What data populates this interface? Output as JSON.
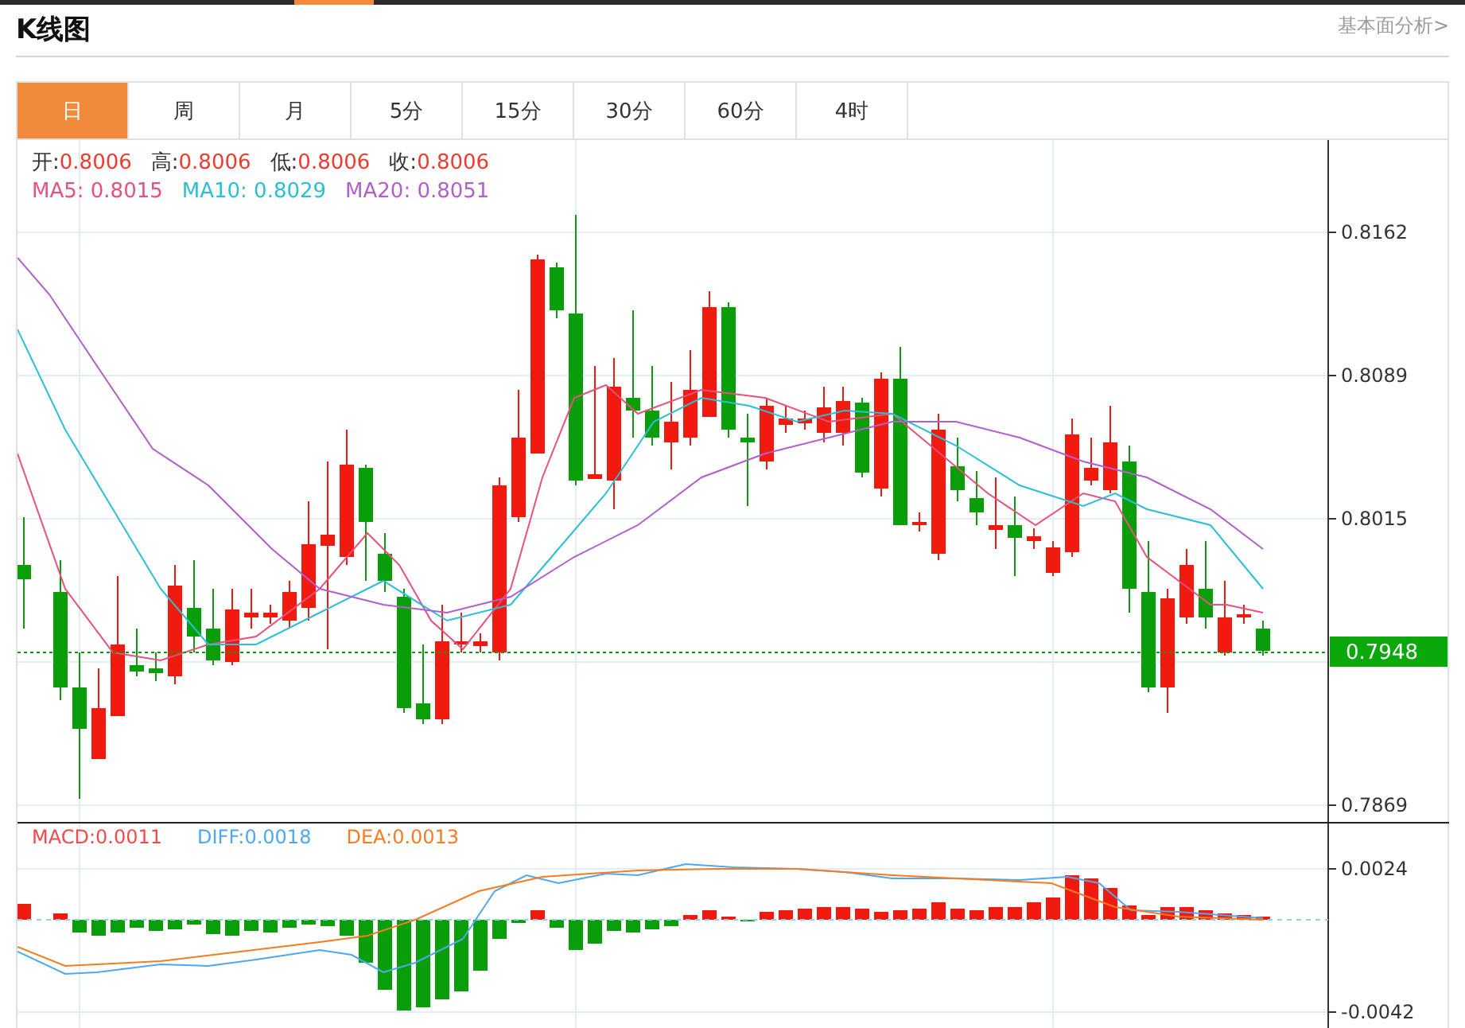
{
  "title": "K线图",
  "link": "基本面分析>",
  "tabs": [
    {
      "label": "日",
      "selected": true
    },
    {
      "label": "周",
      "selected": false
    },
    {
      "label": "月",
      "selected": false
    },
    {
      "label": "5分",
      "selected": false
    },
    {
      "label": "15分",
      "selected": false
    },
    {
      "label": "30分",
      "selected": false
    },
    {
      "label": "60分",
      "selected": false
    },
    {
      "label": "4时",
      "selected": false
    }
  ],
  "ohlc": [
    {
      "label": "开:",
      "value": "0.8006"
    },
    {
      "label": "高:",
      "value": "0.8006"
    },
    {
      "label": "低:",
      "value": "0.8006"
    },
    {
      "label": "收:",
      "value": "0.8006"
    }
  ],
  "moving_averages": [
    {
      "label": "MA5:",
      "value": "0.8015",
      "color": "#e8507d"
    },
    {
      "label": "MA10:",
      "value": "0.8029",
      "color": "#2bbfd6"
    },
    {
      "label": "MA20:",
      "value": "0.8051",
      "color": "#b05fcc"
    }
  ],
  "price_axis": [
    "0.8162",
    "0.8089",
    "0.8015",
    "0.7869"
  ],
  "current_price": "0.7948",
  "macd_legend": [
    {
      "label": "MACD:",
      "value": "0.0011",
      "color": "#f04b4b"
    },
    {
      "label": "DIFF:",
      "value": "0.0018",
      "color": "#4fa8ee"
    },
    {
      "label": "DEA:",
      "value": "0.0013",
      "color": "#f57c20"
    }
  ],
  "macd_axis": [
    "0.0024",
    "-0.0042"
  ]
}
